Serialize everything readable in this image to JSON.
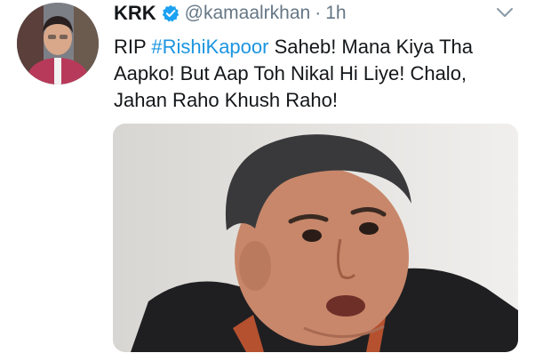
{
  "tweet": {
    "display_name": "KRK",
    "handle": "@kamaalrkhan",
    "separator": "·",
    "time": "1h",
    "text_line1_prefix": "RIP ",
    "hashtag": "#RishiKapoor",
    "text_line1_suffix": " Saheb! Mana Kiya Tha",
    "text_line2": "Aapko! But Aap Toh Nikal Hi Liye! Chalo,",
    "text_line3": "Jahan Raho Khush Raho!"
  },
  "icons": {
    "verified": "verified-badge-icon",
    "menu": "chevron-down-icon"
  },
  "colors": {
    "name": "#14171a",
    "muted": "#657786",
    "link": "#1b95e0",
    "verified": "#1da1f2"
  }
}
